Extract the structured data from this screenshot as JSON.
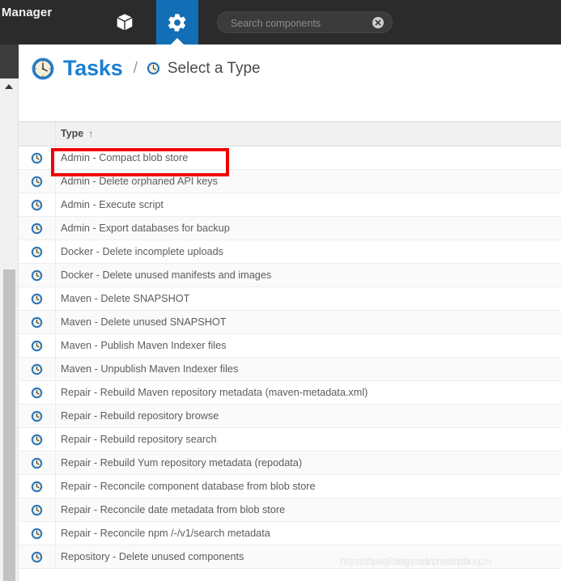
{
  "header": {
    "brand_title": "ory Manager",
    "tabs": [
      {
        "name": "browse",
        "icon": "cube-icon",
        "active": false
      },
      {
        "name": "admin",
        "icon": "gear-icon",
        "active": true
      }
    ],
    "search": {
      "placeholder": "Search components",
      "value": "",
      "clear_icon": "clear-circle-icon"
    }
  },
  "breadcrumb": {
    "icon": "clock-icon",
    "title": "Tasks",
    "separator": "/",
    "current_icon": "clock-small-icon",
    "current": "Select a Type"
  },
  "table": {
    "columns": [
      {
        "key": "icon",
        "label": ""
      },
      {
        "key": "type",
        "label": "Type",
        "sort": "asc",
        "sort_glyph": "↑"
      }
    ],
    "rows": [
      {
        "icon": "clock-icon",
        "type": "Admin - Compact blob store",
        "highlighted": true
      },
      {
        "icon": "clock-icon",
        "type": "Admin - Delete orphaned API keys"
      },
      {
        "icon": "clock-icon",
        "type": "Admin - Execute script"
      },
      {
        "icon": "clock-icon",
        "type": "Admin - Export databases for backup"
      },
      {
        "icon": "clock-icon",
        "type": "Docker - Delete incomplete uploads"
      },
      {
        "icon": "clock-icon",
        "type": "Docker - Delete unused manifests and images"
      },
      {
        "icon": "clock-icon",
        "type": "Maven - Delete SNAPSHOT"
      },
      {
        "icon": "clock-icon",
        "type": "Maven - Delete unused SNAPSHOT"
      },
      {
        "icon": "clock-icon",
        "type": "Maven - Publish Maven Indexer files"
      },
      {
        "icon": "clock-icon",
        "type": "Maven - Unpublish Maven Indexer files"
      },
      {
        "icon": "clock-icon",
        "type": "Repair - Rebuild Maven repository metadata (maven-metadata.xml)"
      },
      {
        "icon": "clock-icon",
        "type": "Repair - Rebuild repository browse"
      },
      {
        "icon": "clock-icon",
        "type": "Repair - Rebuild repository search"
      },
      {
        "icon": "clock-icon",
        "type": "Repair - Rebuild Yum repository metadata (repodata)"
      },
      {
        "icon": "clock-icon",
        "type": "Repair - Reconcile component database from blob store"
      },
      {
        "icon": "clock-icon",
        "type": "Repair - Reconcile date metadata from blob store"
      },
      {
        "icon": "clock-icon",
        "type": "Repair - Reconcile npm /-/v1/search metadata"
      },
      {
        "icon": "clock-icon",
        "type": "Repository - Delete unused components"
      }
    ]
  },
  "scrollbar": {
    "up_arrow_icon": "caret-up-icon",
    "thumb": "scroll-thumb"
  },
  "annotation": {
    "highlight_color": "#f20000",
    "target_row": "Admin - Compact blob store"
  },
  "watermark": {
    "line_a": "https://blog.csdn.net/zhaoqzh",
    "line_b": "https://blog.csdn.net/zhaoqzh"
  },
  "colors": {
    "topbar_bg": "#2b2b2b",
    "accent_blue": "#136fb5",
    "title_blue": "#1a7fd4",
    "row_alt_bg": "#fafafa",
    "header_row_bg": "#f1f1f1",
    "highlight_red": "#f20000"
  }
}
